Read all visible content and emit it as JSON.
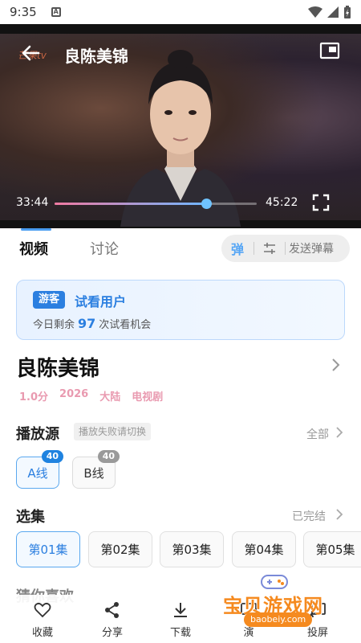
{
  "status_bar": {
    "time": "9:35",
    "notification_letter": "A"
  },
  "player": {
    "logo_text": "芒果tv",
    "title": "良陈美锦",
    "current_time": "33:44",
    "total_time": "45:22",
    "progress": 0.75
  },
  "tabs": {
    "video": "视频",
    "discussion": "讨论"
  },
  "danmu": {
    "toggle_label": "弹",
    "send_label": "发送弹幕"
  },
  "guest": {
    "badge": "游客",
    "title": "试看用户",
    "remaining_prefix": "今日剩余",
    "remaining_count": "97",
    "remaining_suffix": "次试看机会"
  },
  "show": {
    "title": "良陈美锦",
    "score": "1.0分",
    "year": "2026",
    "region": "大陆",
    "type": "电视剧"
  },
  "source": {
    "title": "播放源",
    "hint": "播放失败请切换",
    "all_label": "全部",
    "lines": [
      {
        "label": "A线",
        "count": "40"
      },
      {
        "label": "B线",
        "count": "40"
      }
    ]
  },
  "episodes": {
    "title": "选集",
    "status": "已完结",
    "items": [
      "第01集",
      "第02集",
      "第03集",
      "第04集",
      "第05集"
    ]
  },
  "guess": {
    "title": "猜你喜欢"
  },
  "bottom_bar": {
    "favorite": "收藏",
    "share": "分享",
    "download": "下载",
    "fourth": "演",
    "cast": "投屏"
  },
  "watermark": {
    "text": "宝贝游戏网",
    "url": "baobeiy.com"
  },
  "colors": {
    "accent": "#2b7fe0",
    "meta_pink": "#e99ab0",
    "watermark_orange": "#f58a1f"
  }
}
